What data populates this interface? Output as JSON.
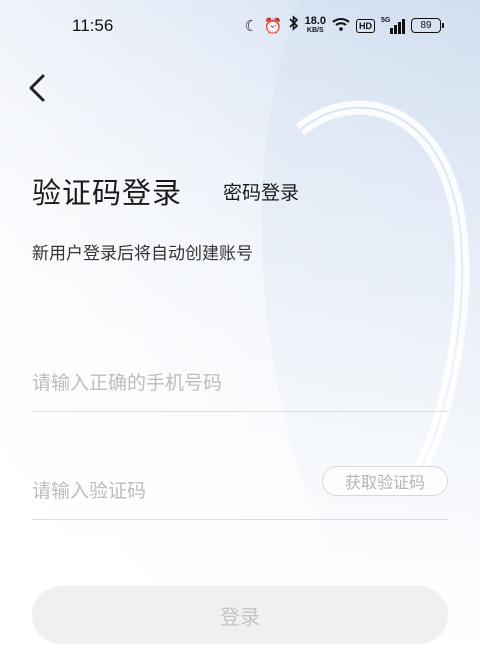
{
  "status_bar": {
    "time": "11:56",
    "net_speed_value": "18.0",
    "net_speed_unit": "KB/S",
    "hd_label": "HD",
    "network_type": "5G",
    "battery_level": "89",
    "icons": [
      "moon-icon",
      "alarm-icon",
      "bluetooth-icon",
      "wifi-icon",
      "signal-icon",
      "battery-icon"
    ]
  },
  "nav": {
    "back_icon": "chevron-left-icon"
  },
  "header": {
    "title": "验证码登录",
    "alt_login_label": "密码登录",
    "subtitle": "新用户登录后将自动创建账号"
  },
  "form": {
    "phone_placeholder": "请输入正确的手机号码",
    "phone_value": "",
    "code_placeholder": "请输入验证码",
    "code_value": "",
    "get_code_label": "获取验证码",
    "submit_label": "登录"
  },
  "colors": {
    "background_accent": "#dbe6f5",
    "text_primary": "#1a1a1a",
    "placeholder": "#bdbdbd",
    "button_disabled_bg": "#f0f0f0",
    "button_disabled_text": "#c4c4c4"
  }
}
